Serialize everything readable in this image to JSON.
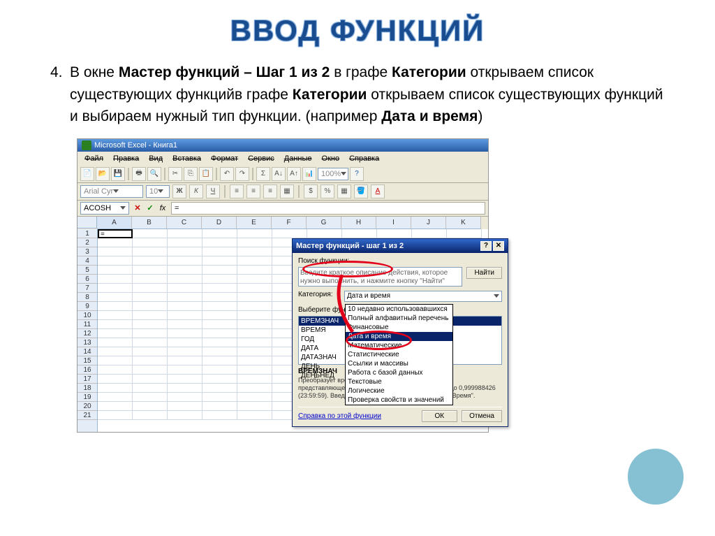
{
  "title": "ВВОД ФУНКЦИЙ",
  "item_number": "4.",
  "body_parts": {
    "p1": "В окне ",
    "b1": "Мастер функций – Шаг 1 из 2",
    "p2": " в графе ",
    "b2": "Категории",
    "p3": " открываем список существующих функцийв графе ",
    "b3": "Категории",
    "p4": " открываем список существующих функций и выбираем нужный тип функции. (например ",
    "b4": "Дата и время",
    "p5": ")"
  },
  "excel": {
    "app_title": "Microsoft Excel - Книга1",
    "menu": [
      "Файл",
      "Правка",
      "Вид",
      "Вставка",
      "Формат",
      "Сервис",
      "Данные",
      "Окно",
      "Справка"
    ],
    "font_name": "Arial Cyr",
    "font_size": "10",
    "zoom": "100%",
    "name_box": "ACOSH",
    "formula": "=",
    "columns": [
      "A",
      "B",
      "C",
      "D",
      "E",
      "F",
      "G",
      "H",
      "I",
      "J",
      "K"
    ],
    "rows": [
      "1",
      "2",
      "3",
      "4",
      "5",
      "6",
      "7",
      "8",
      "9",
      "10",
      "11",
      "12",
      "13",
      "14",
      "15",
      "16",
      "17",
      "18",
      "19",
      "20",
      "21"
    ],
    "cell_a1": "="
  },
  "dialog": {
    "title": "Мастер функций - шаг 1 из 2",
    "search_label": "Поиск функции:",
    "search_placeholder": "Введите краткое описание действия, которое нужно выполнить, и нажмите кнопку \"Найти\"",
    "find_btn": "Найти",
    "category_label": "Категория:",
    "category_value": "Дата и время",
    "select_label": "Выберите функцию:",
    "functions": [
      "ВРЕМЗНАЧ",
      "ВРЕМЯ",
      "ГОД",
      "ДАТА",
      "ДАТАЗНАЧ",
      "ДЕНЬ",
      "ДЕНЬНЕД"
    ],
    "dropdown": [
      "10 недавно использовавшихся",
      "Полный алфавитный перечень",
      "Финансовые",
      "Дата и время",
      "Математические",
      "Статистические",
      "Ссылки и массивы",
      "Работа с базой данных",
      "Текстовые",
      "Логические",
      "Проверка свойств и значений"
    ],
    "desc_title": "ВРЕМЗНАЧ",
    "desc_text": "Преобразует время из текстового формата в число, представляющее время в Excel - число от (0:00:00) до 0,999988426 (23:59:59). Введя формулу, задайте для ячейки тип \"Время\".",
    "help_link": "Справка по этой функции",
    "ok_btn": "ОК",
    "cancel_btn": "Отмена"
  }
}
